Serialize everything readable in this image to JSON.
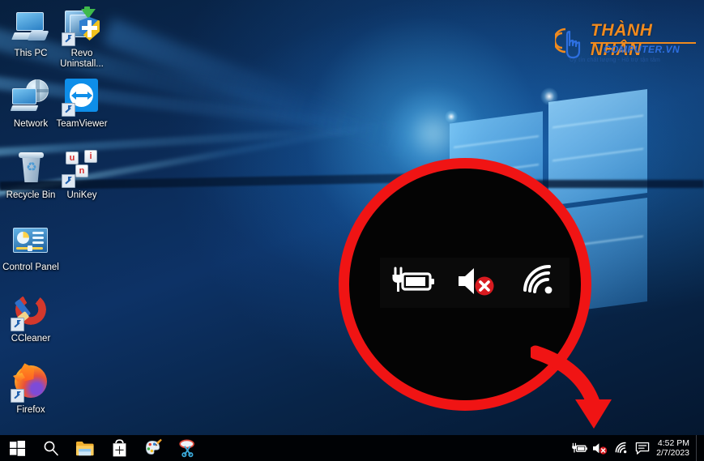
{
  "desktop": {
    "icons": [
      {
        "label": "This PC",
        "icon": "computer-icon",
        "shortcut": false
      },
      {
        "label": "Revo Uninstall...",
        "icon": "revo-uninstaller-icon",
        "shortcut": true
      },
      {
        "label": "Network",
        "icon": "network-icon",
        "shortcut": false
      },
      {
        "label": "TeamViewer",
        "icon": "teamviewer-icon",
        "shortcut": true
      },
      {
        "label": "Recycle Bin",
        "icon": "recycle-bin-icon",
        "shortcut": false
      },
      {
        "label": "UniKey",
        "icon": "unikey-icon",
        "shortcut": true,
        "keys": [
          "u",
          "i",
          "n"
        ]
      },
      {
        "label": "Control Panel",
        "icon": "control-panel-icon",
        "shortcut": false
      },
      {
        "label": "CCleaner",
        "icon": "ccleaner-icon",
        "shortcut": true
      },
      {
        "label": "Firefox",
        "icon": "firefox-icon",
        "shortcut": true
      }
    ],
    "wallpaper": "windows-10-hero-blue"
  },
  "watermark": {
    "title": "THÀNH NHÂN",
    "subtitle": "COMPUTER.VN",
    "tagline": "Uy tín chất lượng - Hỗ trợ tận tâm",
    "icon": "hand-click-icon",
    "title_color": "#f08a1e",
    "subtitle_color": "#2d6fe0"
  },
  "callout": {
    "shape": "circle",
    "ring_color": "#f01414",
    "fill_color": "#040404",
    "arrow_color": "#f01414",
    "arrow_direction": "down-right",
    "magnified_icons": [
      {
        "name": "battery-charging-icon",
        "state": "plugged-in"
      },
      {
        "name": "speaker-muted-icon",
        "state": "muted",
        "badge": "red-x"
      },
      {
        "name": "wifi-icon",
        "state": "connected"
      }
    ]
  },
  "taskbar": {
    "buttons": [
      {
        "name": "start-button",
        "icon": "windows-logo-icon"
      },
      {
        "name": "search-button",
        "icon": "search-icon"
      },
      {
        "name": "file-explorer-button",
        "icon": "folder-icon"
      },
      {
        "name": "microsoft-store-button",
        "icon": "store-bag-icon"
      },
      {
        "name": "paint-3d-button",
        "icon": "paint-palette-icon"
      },
      {
        "name": "snipping-tool-button",
        "icon": "scissors-icon"
      }
    ],
    "tray": [
      {
        "name": "battery-tray-icon",
        "icon": "battery-charging-icon"
      },
      {
        "name": "volume-tray-icon",
        "icon": "speaker-muted-icon",
        "badge": "red-x"
      },
      {
        "name": "network-tray-icon",
        "icon": "wifi-icon"
      },
      {
        "name": "action-center-button",
        "icon": "speech-bubble-icon"
      }
    ],
    "clock": {
      "time": "4:52 PM",
      "date": "2/7/2023"
    }
  }
}
